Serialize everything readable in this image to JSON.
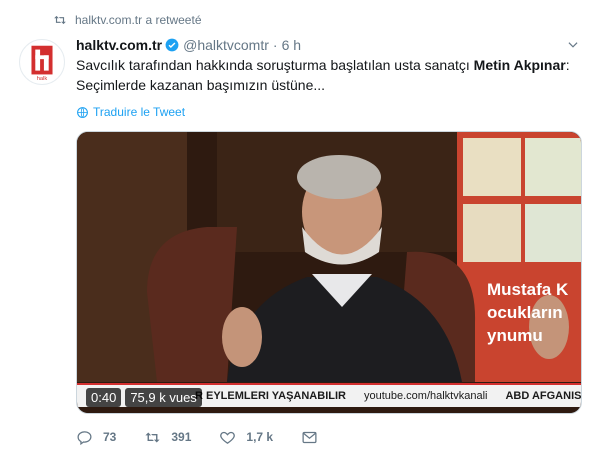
{
  "retweet": {
    "text": "halktv.com.tr a retweeté"
  },
  "tweet": {
    "display_name": "halktv.com.tr",
    "handle": "@halktvcomtr",
    "separator": "·",
    "time": "6 h",
    "text_part1": "Savcılık tarafından hakkında soruşturma başlatılan usta sanatçı ",
    "text_bold": "Metin Akpınar",
    "text_part2": ": Seçimlerde kazanan başımızın üstüne...",
    "translate_label": "Traduire le Tweet"
  },
  "avatar": {
    "logo_label": "halk"
  },
  "media": {
    "duration": "0:40",
    "views": "75,9 k vues",
    "ticker": [
      "R EYLEMLERI YAŞANABILIR",
      "youtube.com/halktvkanali",
      "ABD AFGANISTAN'DA"
    ],
    "book_text": [
      "Mustafa K",
      "ocukların",
      "ynumu"
    ]
  },
  "actions": {
    "replies": "73",
    "retweets": "391",
    "likes": "1,7 k"
  },
  "colors": {
    "accent": "#1da1f2",
    "muted": "#657786",
    "brand_red": "#d32f2f"
  }
}
